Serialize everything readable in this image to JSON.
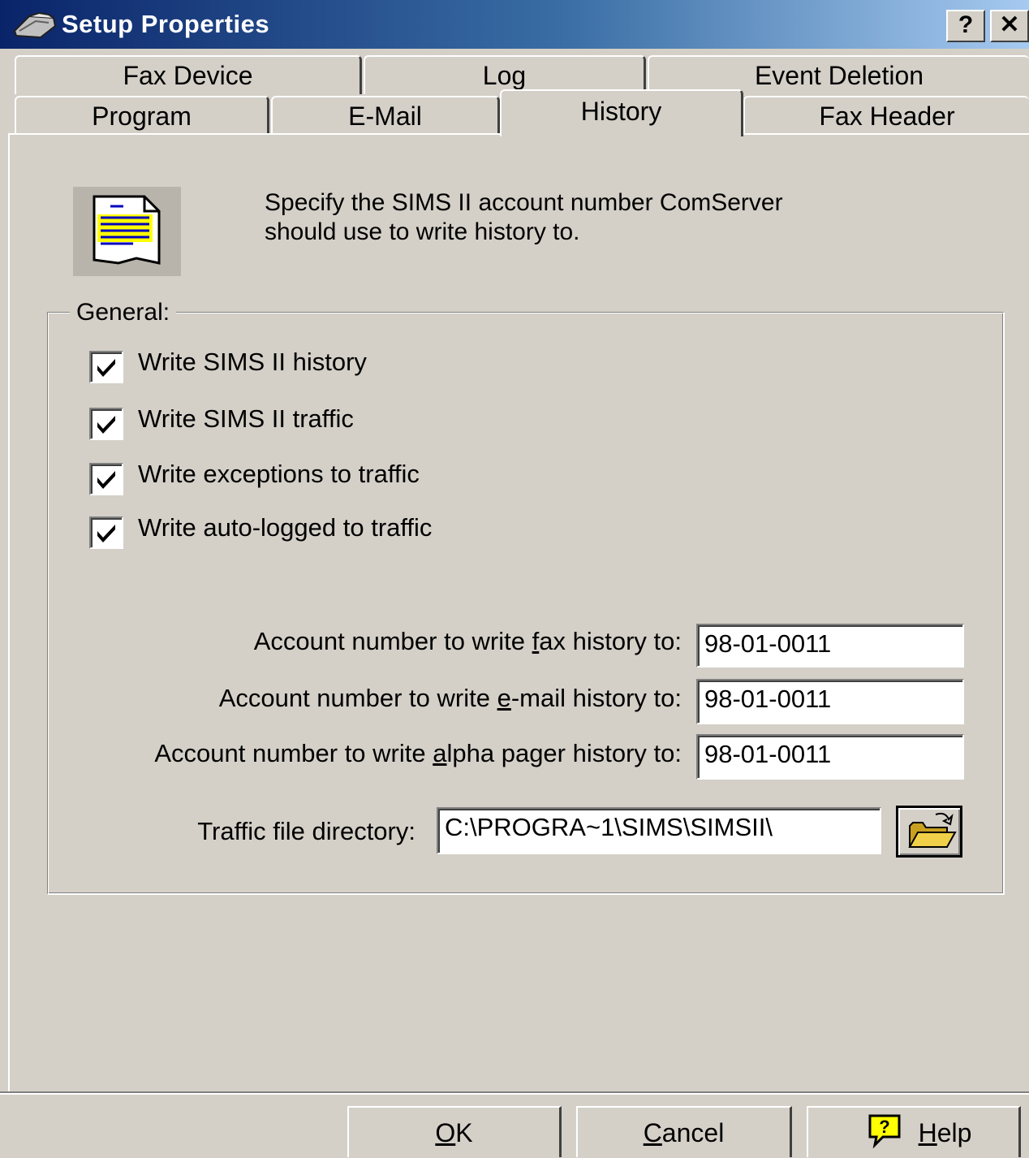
{
  "window": {
    "title": "Setup Properties",
    "help_btn": "?",
    "close_btn": "✕"
  },
  "tabs": {
    "row_back": [
      "Fax Device",
      "Log",
      "Event Deletion"
    ],
    "row_front": [
      "Program",
      "E-Mail",
      "History",
      "Fax Header"
    ],
    "active": "History"
  },
  "description": {
    "line1": "Specify the SIMS II account number ComServer",
    "line2": "should use to write history to."
  },
  "general": {
    "label": "General:",
    "checkboxes": [
      {
        "label": "Write SIMS II history",
        "checked": true
      },
      {
        "label": "Write SIMS II traffic",
        "checked": true
      },
      {
        "label": "Write exceptions to traffic",
        "checked": true
      },
      {
        "label": "Write auto-logged to traffic",
        "checked": true
      }
    ],
    "fax": {
      "pre": "Account number to write ",
      "key": "f",
      "post": "ax history to:",
      "value": "98-01-0011"
    },
    "email": {
      "pre": "Account number to write ",
      "key": "e",
      "post": "-mail history to:",
      "value": "98-01-0011"
    },
    "pager": {
      "pre": "Account number to write ",
      "key": "a",
      "post": "lpha pager history to:",
      "value": "98-01-0011"
    },
    "traffic": {
      "label": "Traffic file directory:",
      "value": "C:\\PROGRA~1\\SIMS\\SIMSII\\"
    }
  },
  "buttons": {
    "ok": {
      "key": "O",
      "rest": "K"
    },
    "cancel": {
      "key": "C",
      "rest": "ancel"
    },
    "help": {
      "key": "H",
      "rest": "elp"
    }
  }
}
